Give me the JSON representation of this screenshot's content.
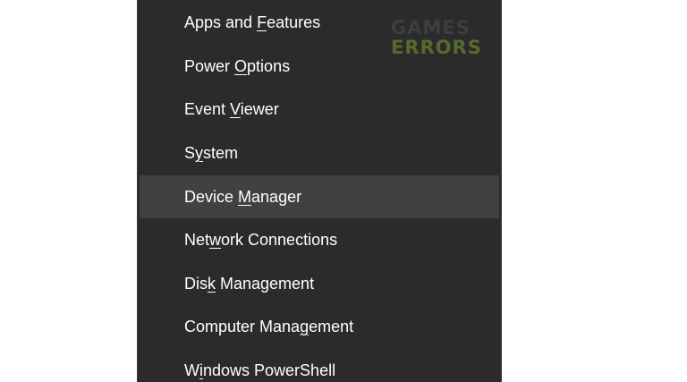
{
  "menu": {
    "items": [
      {
        "pre": "Apps and ",
        "key": "F",
        "post": "eatures"
      },
      {
        "pre": "Power ",
        "key": "O",
        "post": "ptions"
      },
      {
        "pre": "Event ",
        "key": "V",
        "post": "iewer"
      },
      {
        "pre": "S",
        "key": "y",
        "post": "stem"
      },
      {
        "pre": "Device ",
        "key": "M",
        "post": "anager"
      },
      {
        "pre": "Net",
        "key": "w",
        "post": "ork Connections"
      },
      {
        "pre": "Dis",
        "key": "k",
        "post": " Management"
      },
      {
        "pre": "Computer Mana",
        "key": "g",
        "post": "ement"
      },
      {
        "pre": "W",
        "key": "i",
        "post": "ndows PowerShell"
      }
    ],
    "hovered_item": "Device Manager"
  },
  "watermark": {
    "line1": "GAMES",
    "line2": "ERRORS"
  },
  "colors": {
    "menu_background": "#2b2b2b",
    "hover_background": "#414141",
    "menu_text": "#ffffff",
    "watermark_games": "#3e3e3e",
    "watermark_errors": "#566a2c"
  }
}
